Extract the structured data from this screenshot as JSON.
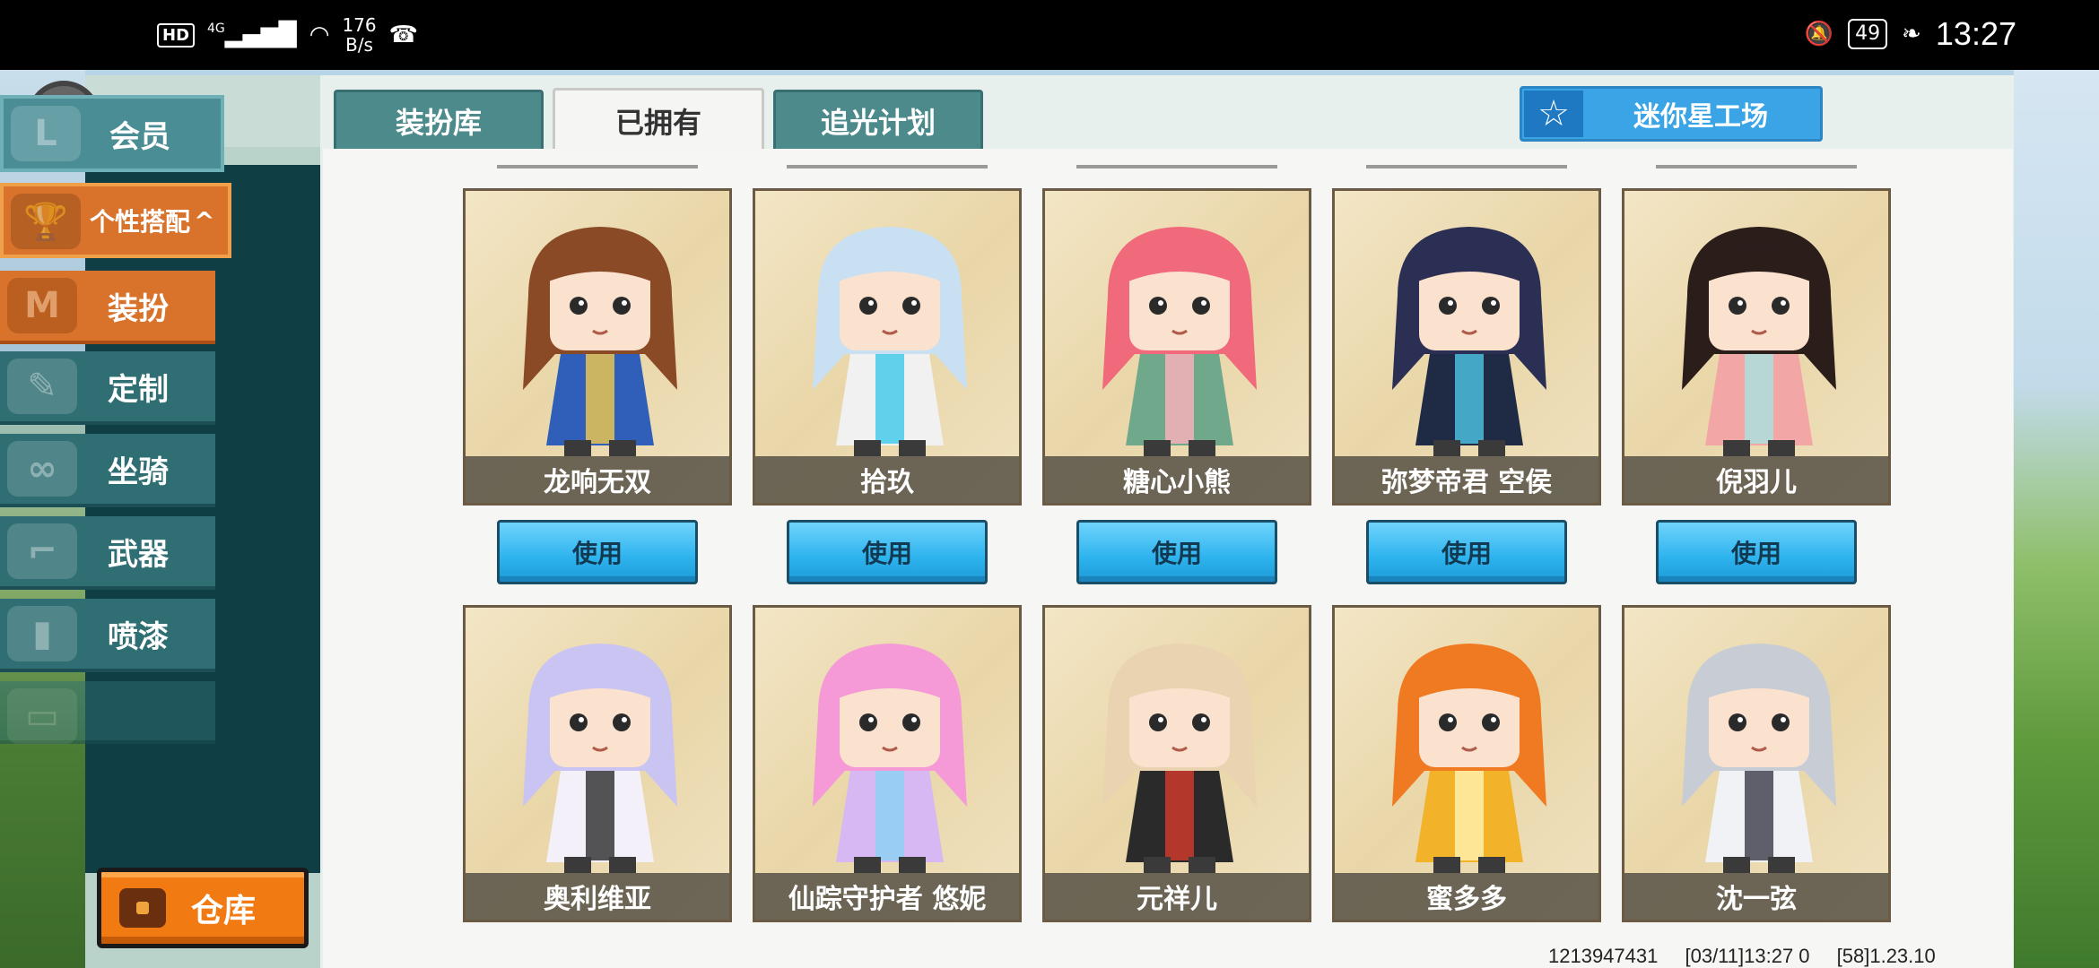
{
  "status_bar": {
    "hd": "HD",
    "network": "4G",
    "speed_value": "176",
    "speed_unit": "B/s",
    "battery": "49",
    "time": "13:27"
  },
  "sidebar": {
    "member": "会员",
    "personal": "个性搭配",
    "items": [
      {
        "label": "装扮",
        "icon": "shirt-icon"
      },
      {
        "label": "定制",
        "icon": "pencil-icon"
      },
      {
        "label": "坐骑",
        "icon": "saddle-icon"
      },
      {
        "label": "武器",
        "icon": "gun-icon"
      },
      {
        "label": "喷漆",
        "icon": "spray-can-icon"
      }
    ],
    "warehouse": "仓库"
  },
  "tabs": [
    "装扮库",
    "已拥有",
    "追光计划"
  ],
  "active_tab": "已拥有",
  "mini_star": "迷你星工场",
  "use_label": "使用",
  "row1": [
    {
      "name": "龙响无双",
      "hair": "#8a4a26",
      "outfit": "#2f5fb8",
      "accent": "#f2c94c"
    },
    {
      "name": "拾玖",
      "hair": "#c9dff2",
      "outfit": "#f1f1f1",
      "accent": "#3cc9e8"
    },
    {
      "name": "糖心小熊",
      "hair": "#f06a7c",
      "outfit": "#6fa88a",
      "accent": "#ffb0bc"
    },
    {
      "name": "弥梦帝君 空侯",
      "hair": "#2c2f54",
      "outfit": "#1f2a44",
      "accent": "#4cc7e6"
    },
    {
      "name": "倪羽儿",
      "hair": "#2a1d1a",
      "outfit": "#f3a6a6",
      "accent": "#a8e4e0"
    }
  ],
  "row2": [
    {
      "name": "奥利维亚",
      "hair": "#c9c4f2",
      "outfit": "#f4f0fa",
      "accent": "#2a2a2a"
    },
    {
      "name": "仙踪守护者 悠妮",
      "hair": "#f59ad6",
      "outfit": "#d8b8f2",
      "accent": "#8ad2f2"
    },
    {
      "name": "元祥儿",
      "hair": "#e9d3b0",
      "outfit": "#2a2a2a",
      "accent": "#d63b2c"
    },
    {
      "name": "蜜多多",
      "hair": "#f07a22",
      "outfit": "#f2b22a",
      "accent": "#fff2b0"
    },
    {
      "name": "沈一弦",
      "hair": "#c8ccd4",
      "outfit": "#f0f2f6",
      "accent": "#3a3a48"
    }
  ],
  "footer": {
    "id": "1213947431",
    "date": "[03/11]13:27 0",
    "version": "[58]1.23.10"
  }
}
